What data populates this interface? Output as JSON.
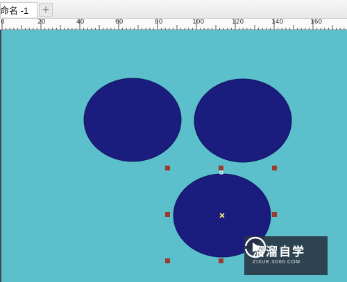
{
  "document_tab": {
    "title": "命名 -1",
    "add_tab_symbol": "+"
  },
  "ruler": {
    "labels": [
      "0",
      "20",
      "40",
      "60",
      "80",
      "100",
      "120",
      "140",
      "160"
    ]
  },
  "canvas": {
    "background_color": "#5bbfcc",
    "shape_fill_color": "#1b1d7e",
    "shape_stroke_color": "#121460",
    "handle_color": "#9b3b2e"
  },
  "watermark": {
    "title": "溜溜自学",
    "subtitle": "ZIXUE.3D66.COM"
  }
}
